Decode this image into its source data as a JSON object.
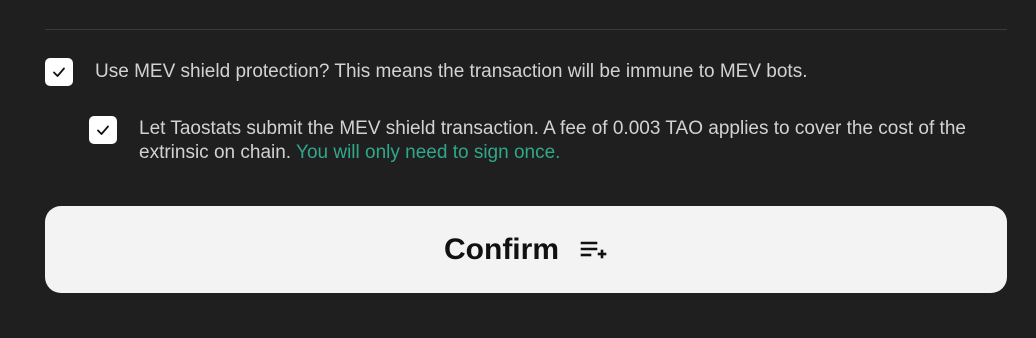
{
  "options": [
    {
      "checked": true,
      "label": "Use MEV shield protection? This means the transaction will be immune to MEV bots.",
      "icon": "checkmark-icon"
    },
    {
      "checked": true,
      "label": "Let Taostats submit the MEV shield transaction. A fee of 0.003 TAO applies to cover the cost of the extrinsic on chain.",
      "highlight": "You will only need to sign once.",
      "icon": "checkmark-icon"
    }
  ],
  "confirm": {
    "label": "Confirm",
    "icon": "playlist-add-icon"
  },
  "colors": {
    "background": "#1f1f1f",
    "highlight": "#2fa88a",
    "button": "#f3f3f3"
  }
}
